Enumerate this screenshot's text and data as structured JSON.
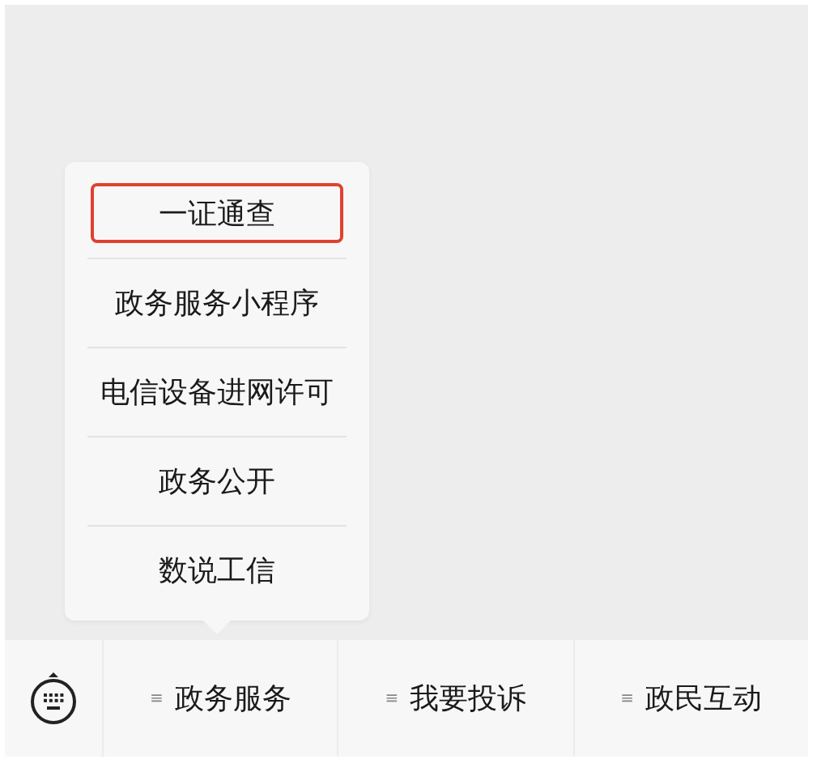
{
  "submenu": {
    "items": [
      {
        "label": "一证通查",
        "selected": true
      },
      {
        "label": "政务服务小程序",
        "selected": false
      },
      {
        "label": "电信设备进网许可",
        "selected": false
      },
      {
        "label": "政务公开",
        "selected": false
      },
      {
        "label": "数说工信",
        "selected": false
      }
    ]
  },
  "menu_bar": {
    "items": [
      {
        "label": "政务服务",
        "mark": "≡"
      },
      {
        "label": "我要投诉",
        "mark": "≡"
      },
      {
        "label": "政民互动",
        "mark": "≡"
      }
    ]
  }
}
